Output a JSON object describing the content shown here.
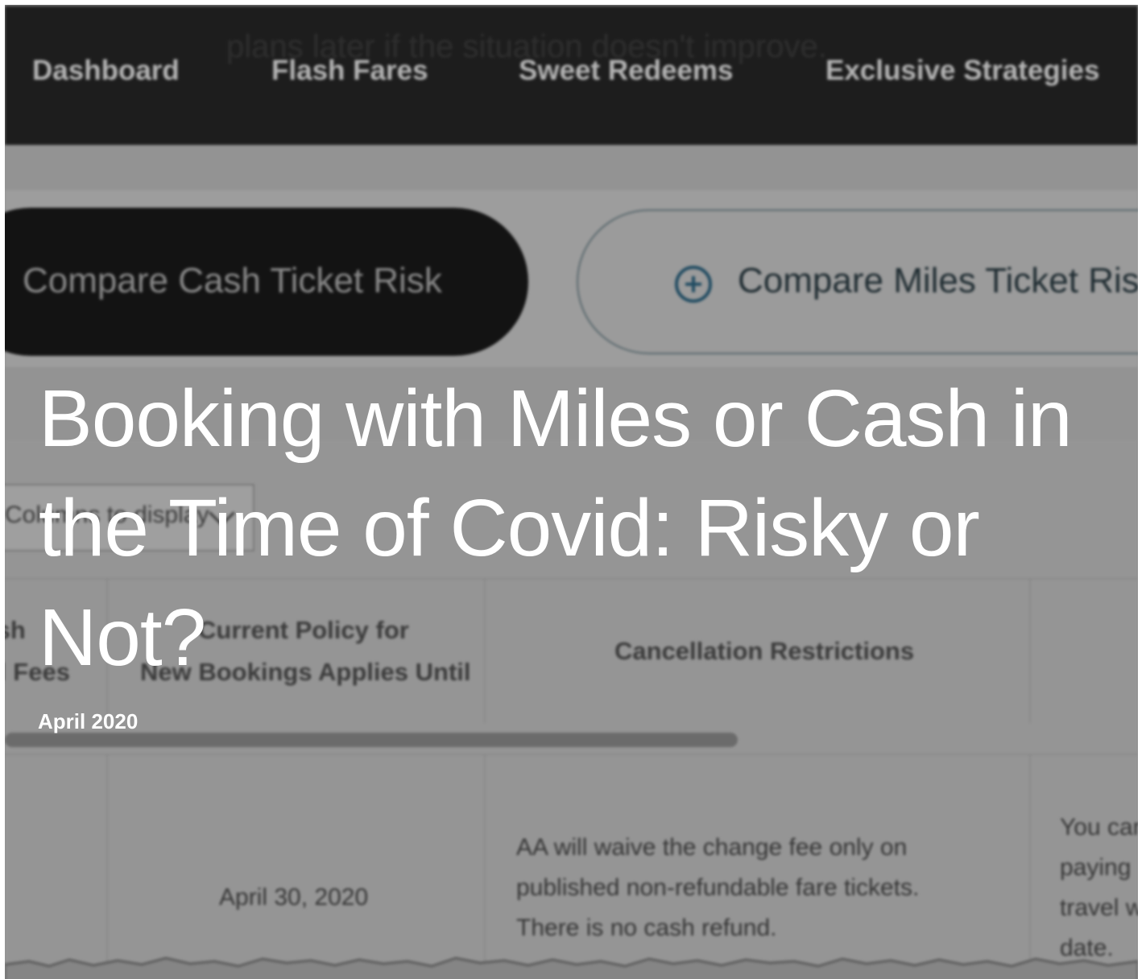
{
  "background": {
    "ghost_text": "plans later if the situation doesn't improve.",
    "nav": {
      "items": [
        {
          "label": "Dashboard"
        },
        {
          "label": "Flash Fares"
        },
        {
          "label": "Sweet Redeems"
        },
        {
          "label": "Exclusive Strategies"
        }
      ]
    },
    "pills": {
      "cash_label": "Compare Cash Ticket Risk",
      "miles_label": "Compare Miles Ticket Risk",
      "miles_icon": "plus-circle-icon"
    },
    "column_select": {
      "label": "Columns to display",
      "icon": "chevron-down-icon"
    },
    "table": {
      "headers": {
        "col1_line1": "Cash",
        "col1_line2": "Cancel Fees",
        "col2_line1": "Current Policy for",
        "col2_line2": "New Bookings Applies Until",
        "col3": "Cancellation Restrictions"
      },
      "row": {
        "date": "April 30, 2020",
        "restriction_lines": [
          "AA will waive the change fee only on",
          "published non-refundable fare tickets.",
          "There is no cash refund."
        ],
        "next_col_lines": [
          "You can",
          "paying",
          "travel w",
          "date."
        ]
      }
    }
  },
  "article": {
    "title": "Booking with Miles or Cash in the Time of Covid: Risky or Not?",
    "date": "April 2020"
  },
  "colors": {
    "top_bar": "#1a1a1a",
    "background_gray": "#9a9a9a",
    "headline_text": "#ffffff",
    "icon_accent": "#1e4c64"
  }
}
